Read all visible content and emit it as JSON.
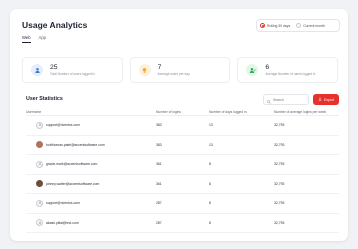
{
  "page": {
    "title": "Usage Analytics"
  },
  "range": {
    "options": [
      {
        "label": "Rolling 30 days",
        "selected": true
      },
      {
        "label": "Current month",
        "selected": false
      }
    ]
  },
  "tabs": [
    {
      "label": "Web",
      "active": true
    },
    {
      "label": "App",
      "active": false
    }
  ],
  "stats": [
    {
      "value": "25",
      "label": "Total Number of users logged in",
      "icon": "users-icon",
      "color": "#3b7ddd"
    },
    {
      "value": "7",
      "label": "Average users per day",
      "icon": "lightbulb-icon",
      "color": "#f2a93b"
    },
    {
      "value": "6",
      "label": "Average Number of users logged in",
      "icon": "user-check-icon",
      "color": "#2fae5b"
    }
  ],
  "user_stats": {
    "title": "User Statistics",
    "search_placeholder": "Search",
    "export_label": "Export",
    "columns": [
      "Username",
      "Number of logins",
      "Number of days logged in",
      "Number of average logins per week"
    ],
    "rows": [
      {
        "username": "support@ricentus.com",
        "logins": "383",
        "days": "13",
        "avg": "32,793",
        "avatar": "generic"
      },
      {
        "username": "bobthomas.patel@accentsoftware.com",
        "logins": "383",
        "days": "13",
        "avg": "32,793",
        "avatar": "photo"
      },
      {
        "username": "gracie.mark@accentsoftware.com",
        "logins": "361",
        "days": "8",
        "avg": "32,793",
        "avatar": "generic"
      },
      {
        "username": "johnny.walter@accentsoftware.com",
        "logins": "361",
        "days": "8",
        "avg": "32,793",
        "avatar": "photo"
      },
      {
        "username": "support@ricentus.com",
        "logins": "287",
        "days": "8",
        "avg": "32,793",
        "avatar": "generic"
      },
      {
        "username": "akash.pillai@ieci.com",
        "logins": "287",
        "days": "8",
        "avg": "32,793",
        "avatar": "generic"
      }
    ]
  },
  "colors": {
    "accent": "#e5322d",
    "background": "#f1f2f5"
  }
}
